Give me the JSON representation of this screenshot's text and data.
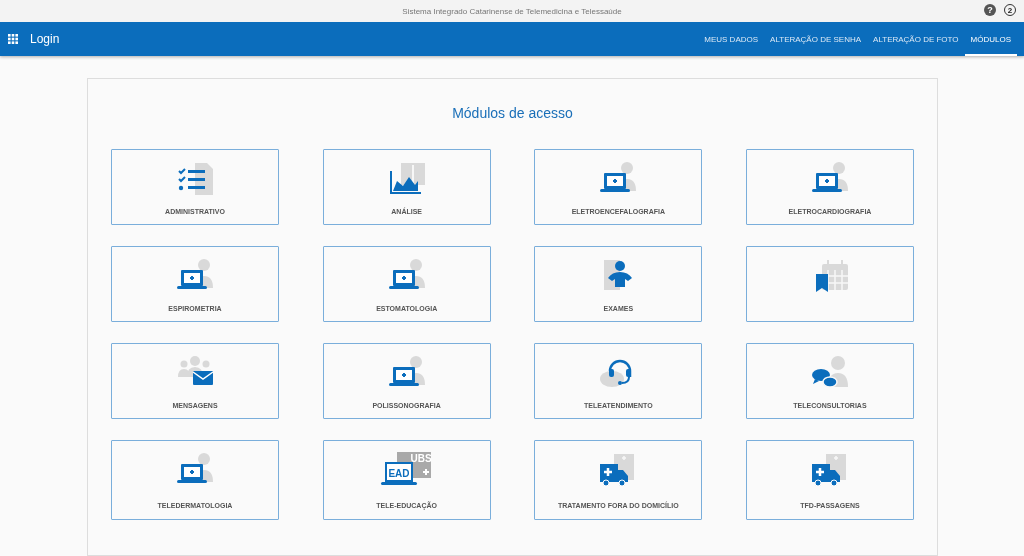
{
  "top_bar": {
    "title": "Sistema Integrado Catarinense de Telemedicina e Telessaúde",
    "help": "?",
    "badge": "2"
  },
  "nav": {
    "title": "Login",
    "tabs": [
      {
        "label": "MEUS DADOS",
        "selected": false
      },
      {
        "label": "ALTERAÇÃO DE SENHA",
        "selected": false
      },
      {
        "label": "ALTERAÇÃO DE FOTO",
        "selected": false
      },
      {
        "label": "MÓDULOS",
        "selected": true
      }
    ]
  },
  "panel": {
    "title": "Módulos de acesso",
    "modules": [
      {
        "label": "ADMINISTRATIVO",
        "kind": "checklist"
      },
      {
        "label": "ANÁLISE",
        "kind": "chart"
      },
      {
        "label": "ELETROENCEFALOGRAFIA",
        "kind": "telemed"
      },
      {
        "label": "ELETROCARDIOGRAFIA",
        "kind": "telemed"
      },
      {
        "label": "ESPIROMETRIA",
        "kind": "telemed"
      },
      {
        "label": "ESTOMATOLOGIA",
        "kind": "telemed"
      },
      {
        "label": "EXAMES",
        "kind": "exam"
      },
      {
        "kind": "calendar"
      },
      {
        "label": "MENSAGENS",
        "kind": "messages"
      },
      {
        "label": "POLISSONOGRAFIA",
        "kind": "telemed"
      },
      {
        "label": "TELEATENDIMENTO",
        "kind": "headset"
      },
      {
        "label": "TELECONSULTORIAS",
        "kind": "chat"
      },
      {
        "label": "TELEDERMATOLOGIA",
        "kind": "telemed"
      },
      {
        "label": "TELE-EDUCAÇÃO",
        "kind": "ead",
        "icon_texts": [
          "EAD",
          "UBS"
        ]
      },
      {
        "label": "TRATAMENTO FORA DO DOMICÍLIO",
        "kind": "ambulance"
      },
      {
        "label": "TFD-PASSAGENS",
        "kind": "ambulance"
      }
    ]
  }
}
